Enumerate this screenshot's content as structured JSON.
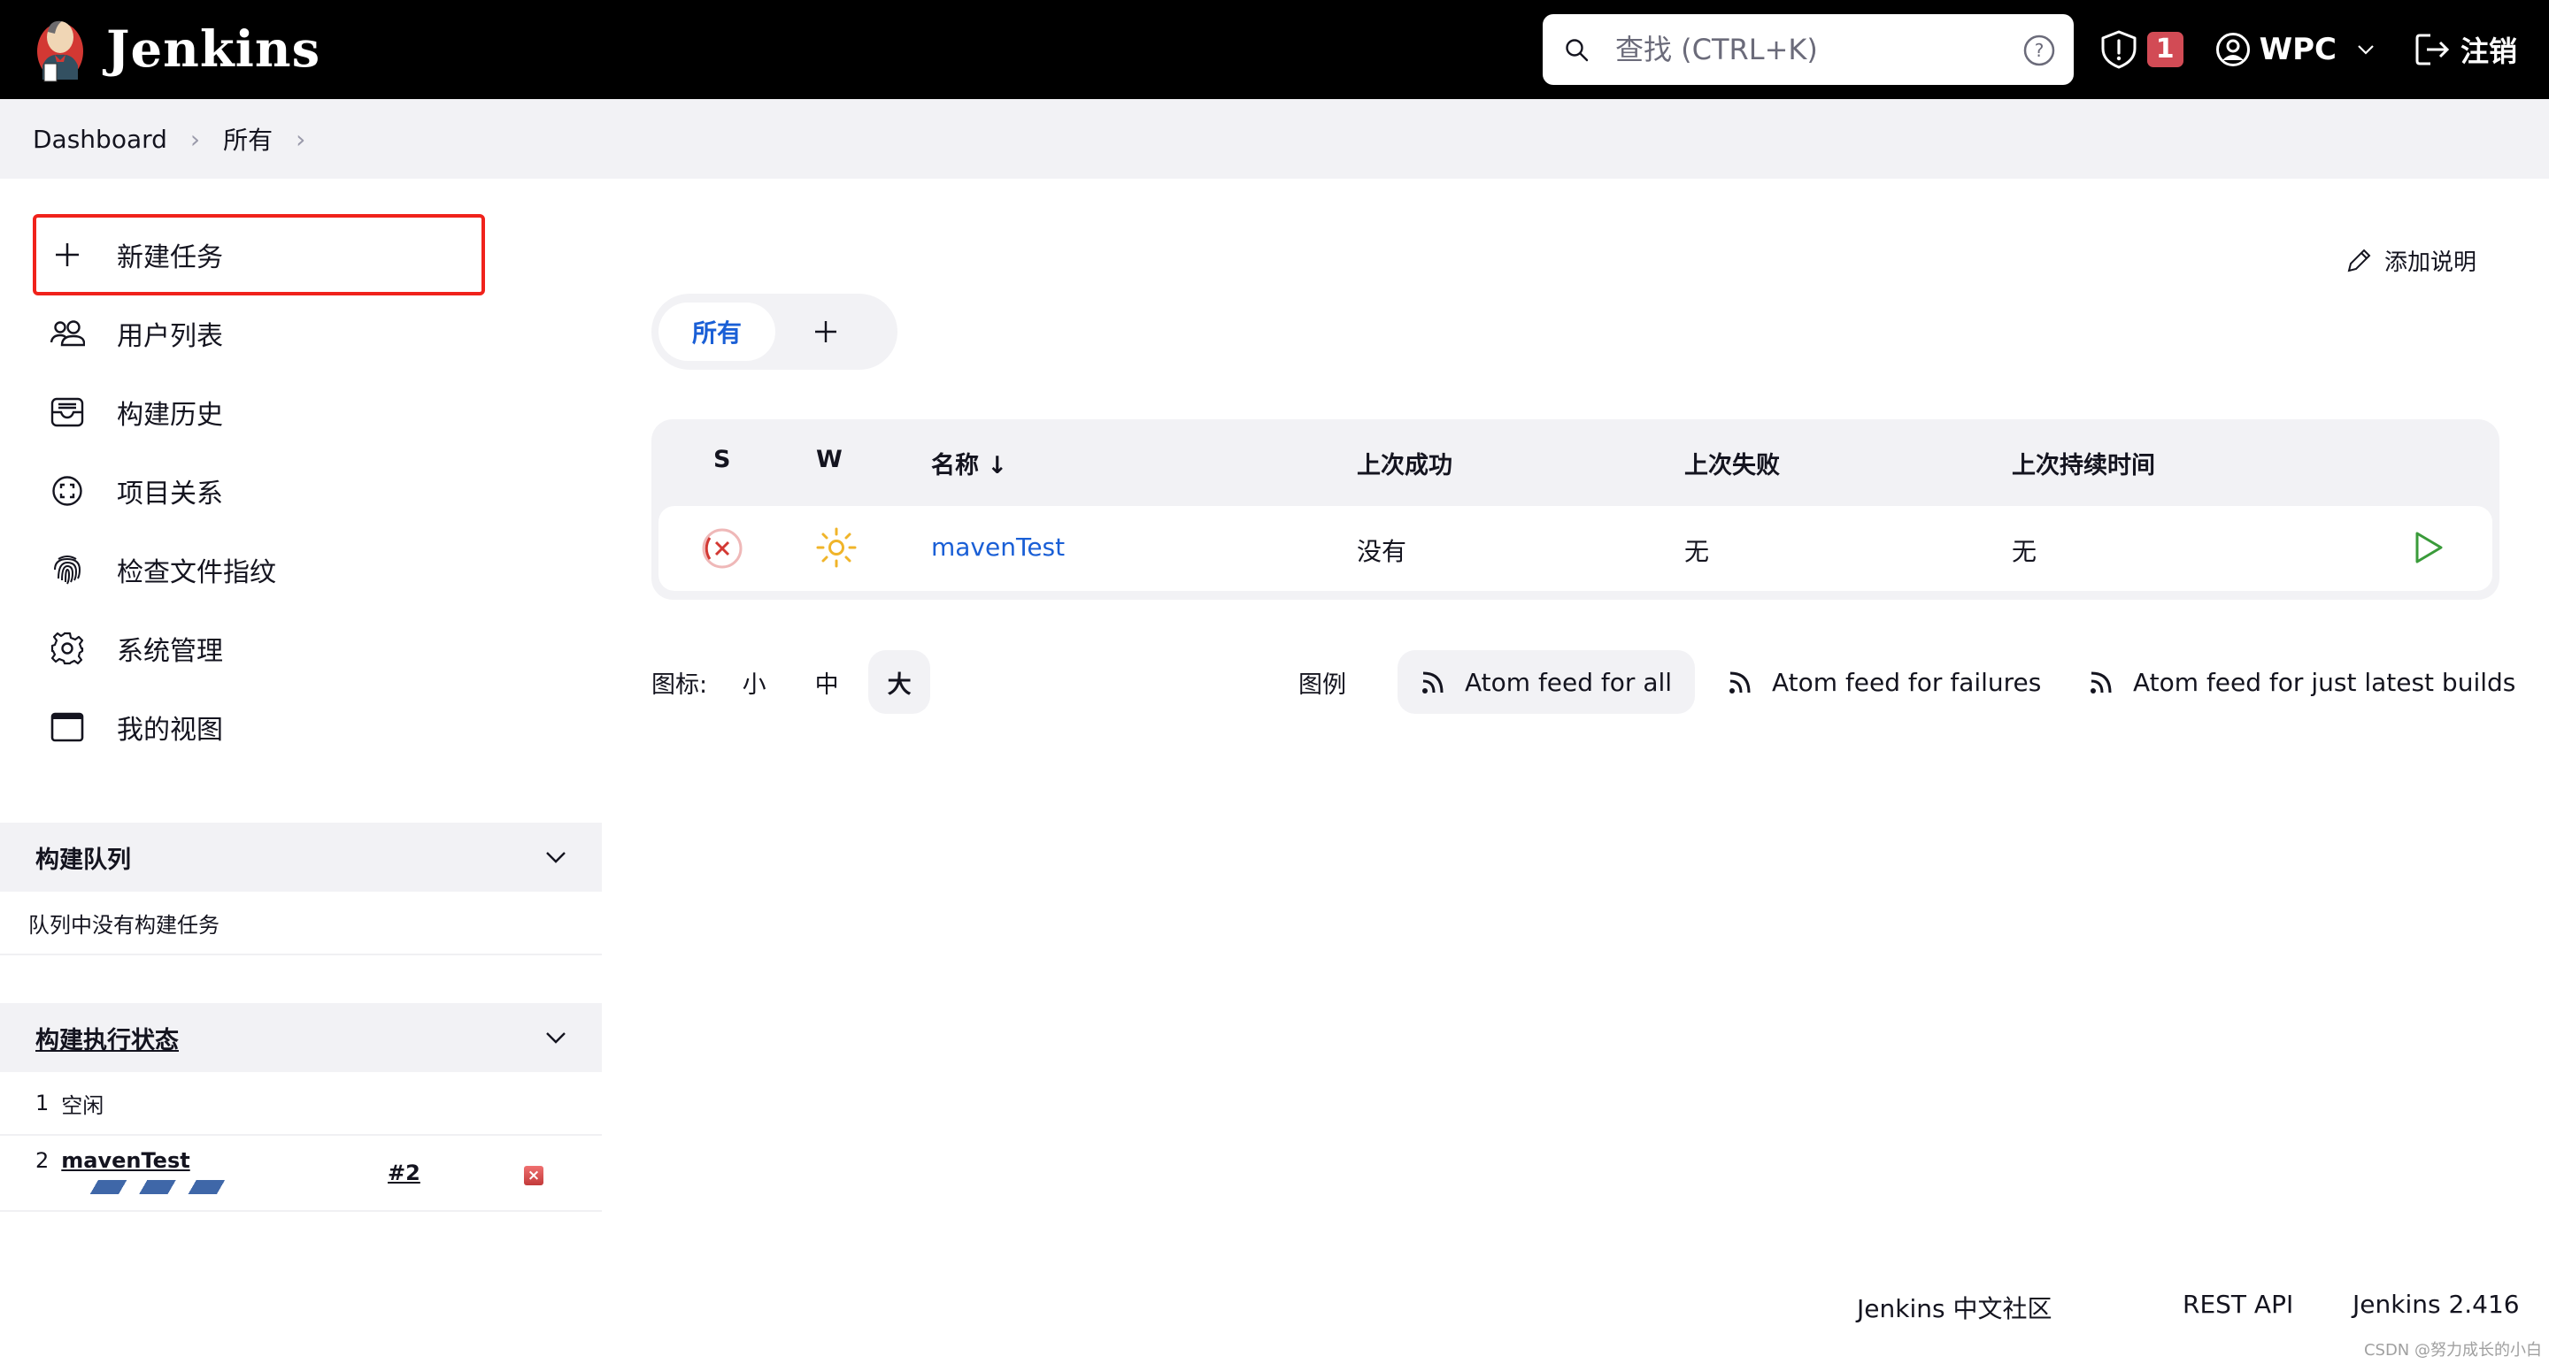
{
  "header": {
    "app_name": "Jenkins",
    "search_placeholder": "查找 (CTRL+K)",
    "security_badge_count": "1",
    "user_name": "WPC",
    "logout_label": "注销"
  },
  "breadcrumb": [
    "Dashboard",
    "所有"
  ],
  "sidebar": {
    "tasks": [
      {
        "label": "新建任务",
        "icon": "plus-icon"
      },
      {
        "label": "用户列表",
        "icon": "users-icon"
      },
      {
        "label": "构建历史",
        "icon": "inbox-icon"
      },
      {
        "label": "项目关系",
        "icon": "relationship-icon"
      },
      {
        "label": "检查文件指纹",
        "icon": "fingerprint-icon"
      },
      {
        "label": "系统管理",
        "icon": "gear-icon"
      },
      {
        "label": "我的视图",
        "icon": "window-icon"
      }
    ],
    "build_queue": {
      "title": "构建队列",
      "empty_text": "队列中没有构建任务"
    },
    "executors": {
      "title": "构建执行状态",
      "rows": [
        {
          "number": "1",
          "status": "空闲"
        },
        {
          "number": "2",
          "job": "mavenTest",
          "build": "#2"
        }
      ]
    }
  },
  "main": {
    "add_description": "添加说明",
    "tabs": [
      {
        "label": "所有",
        "active": true
      }
    ],
    "table": {
      "headers": [
        "S",
        "W",
        "名称 ↓",
        "上次成功",
        "上次失败",
        "上次持续时间"
      ],
      "rows": [
        {
          "status": "failed",
          "weather": "sunny",
          "name": "mavenTest",
          "last_success": "没有",
          "last_failure": "无",
          "last_duration": "无"
        }
      ]
    },
    "icon_size": {
      "label": "图标:",
      "options": [
        "小",
        "中",
        "大"
      ],
      "selected": "大"
    },
    "legend_label": "图例",
    "feeds": [
      "Atom feed for all",
      "Atom feed for failures",
      "Atom feed for just latest builds"
    ]
  },
  "footer": {
    "community": "Jenkins 中文社区",
    "rest_api": "REST API",
    "version": "Jenkins 2.416"
  },
  "watermark": "CSDN @努力成长的小白",
  "colors": {
    "accent": "#1a5fd6",
    "badge": "#d24b55",
    "highlight_box": "#f0221b",
    "run": "#3a9b3a",
    "failed": "#d33833",
    "weather": "#f0b429"
  }
}
